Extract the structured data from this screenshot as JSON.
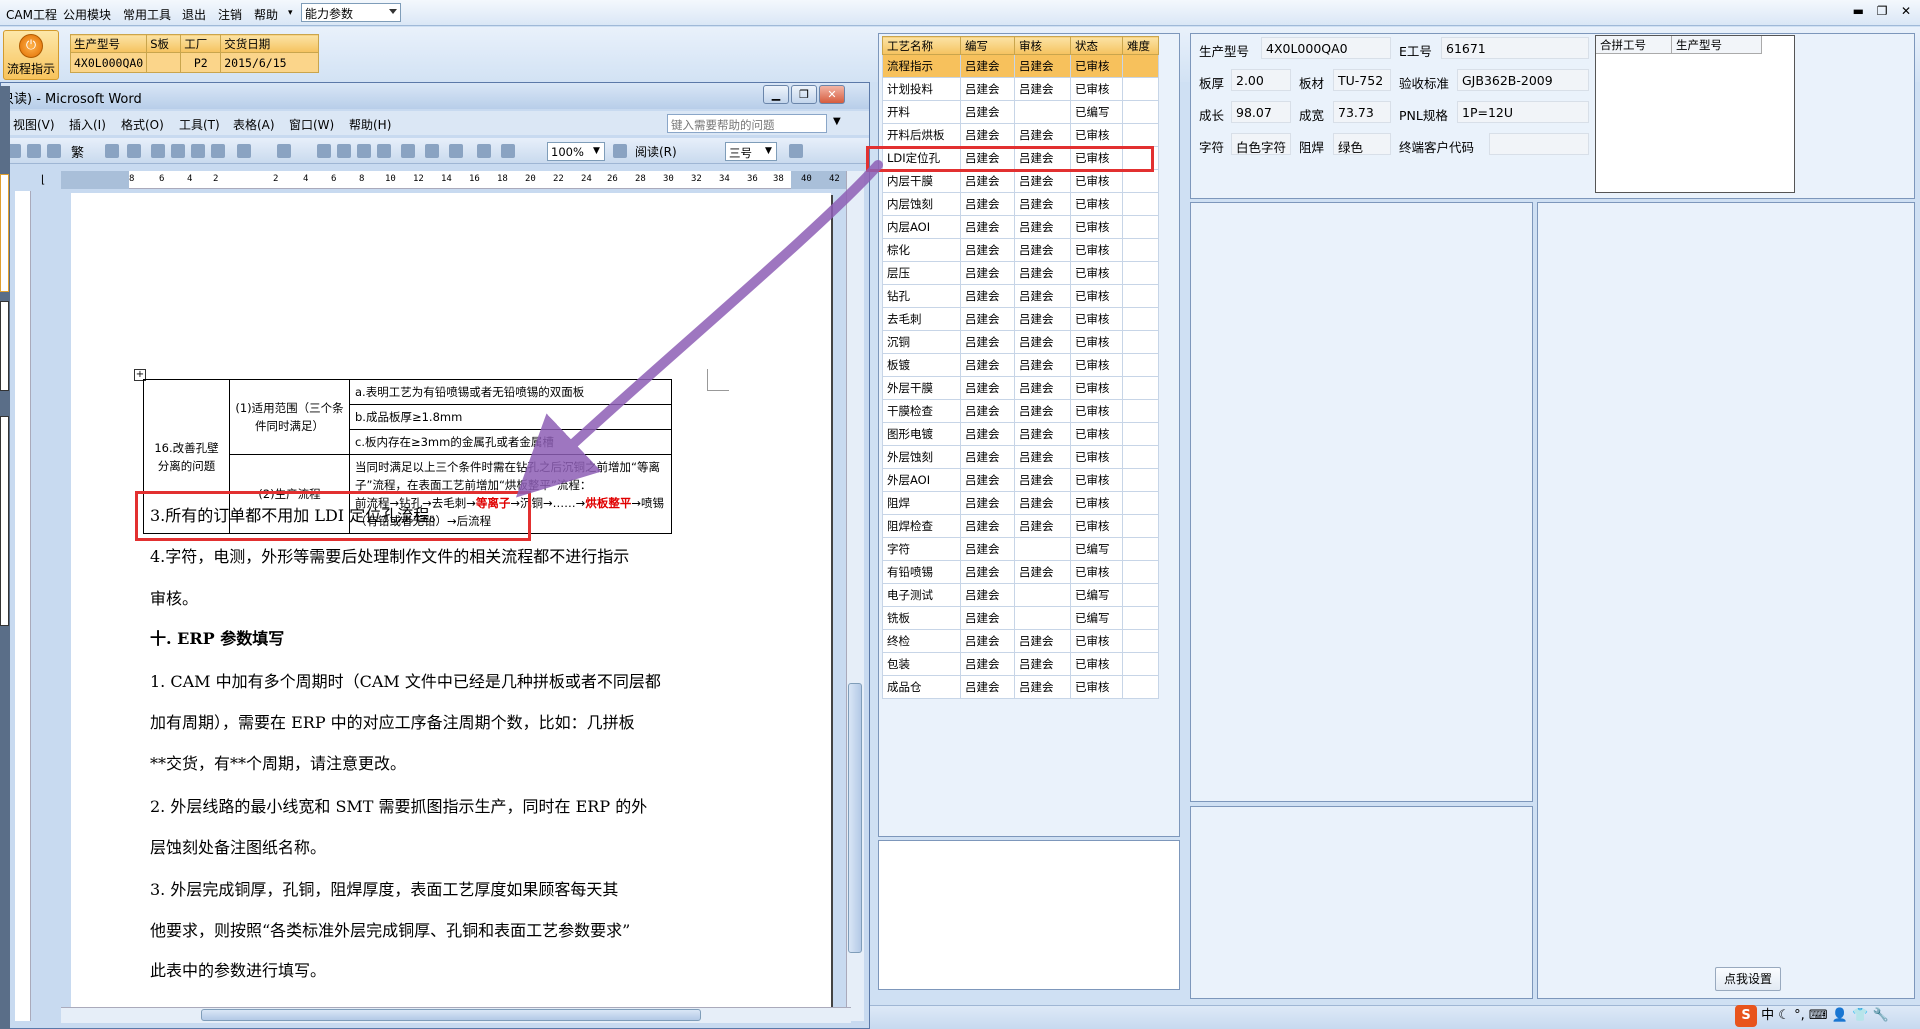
{
  "menubar": {
    "items": [
      "CAM工程",
      "公用模块",
      "常用工具",
      "退出",
      "注销",
      "帮助"
    ],
    "param_combo": "能力参数"
  },
  "ribbon": {
    "flow_button": "流程指示",
    "order_grid": {
      "headers": [
        "生产型号",
        "S板",
        "工厂",
        "交货日期"
      ],
      "row": [
        "4X0L000QA0",
        "",
        "P2",
        "2015/6/15"
      ]
    }
  },
  "word": {
    "title": "只读) - Microsoft Word",
    "menu": [
      "视图(V)",
      "插入(I)",
      "格式(O)",
      "工具(T)",
      "表格(A)",
      "窗口(W)",
      "帮助(H)"
    ],
    "help_placeholder": "键入需要帮助的问题",
    "zoom": "100%",
    "read_label": "阅读(R)",
    "font_size": "三号",
    "ruler_numbers": [
      "8",
      "6",
      "4",
      "2",
      "2",
      "4",
      "6",
      "8",
      "10",
      "12",
      "14",
      "16",
      "18",
      "20",
      "22",
      "24",
      "26",
      "28",
      "30",
      "32",
      "34",
      "36",
      "38",
      "40",
      "42"
    ],
    "table": {
      "item": "16.改善孔壁分离的问题",
      "scope_label": "(1)适用范围（三个条件同时满足）",
      "scope": [
        "a.表明工艺为有铅喷锡或者无铅喷锡的双面板",
        "b.成品板厚≥1.8mm",
        "c.板内存在≥3mm的金属孔或者金属槽"
      ],
      "flow_label": "(2)生产流程",
      "flow_text_1": "当同时满足以上三个条件时需在钻孔之后沉铜之前增加“等离子”流程，在表面工艺前增加“烘板整平”流程：",
      "flow_text_2a": "前流程→钻孔→去毛刺→",
      "flow_text_2b": "等离子",
      "flow_text_2c": "→沉铜→……→",
      "flow_text_2d": "烘板整平",
      "flow_text_2e": "→喷锡（有铅或者无铅）→后流程"
    },
    "lines": {
      "l3": "3.所有的订单都不用加 LDI 定位孔流程。",
      "l4a": "4.字符，电测，外形等需要后处理制作文件的相关流程都不进行指示",
      "l4b": "审核。",
      "h10": "十. ERP 参数填写",
      "p1a": "1. CAM 中加有多个周期时（CAM 文件中已经是几种拼板或者不同层都",
      "p1b": "加有周期），需要在 ERP 中的对应工序备注周期个数，比如：几拼板",
      "p1c": "**交货，有**个周期，请注意更改。",
      "p2a": "2. 外层线路的最小线宽和 SMT 需要抓图指示生产，同时在 ERP 的外",
      "p2b": "层蚀刻处备注图纸名称。",
      "p3a": "3. 外层完成铜厚，孔铜，阻焊厚度，表面工艺厚度如果顾客每天其",
      "p3b": "他要求，则按照“各类标准外层完成铜厚、孔铜和表面工艺参数要求”",
      "p3c": "此表中的参数进行填写。"
    }
  },
  "process": {
    "headers": [
      "工艺名称",
      "编写",
      "审核",
      "状态",
      "难度"
    ],
    "rows": [
      [
        "流程指示",
        "吕建会",
        "吕建会",
        "已审核",
        ""
      ],
      [
        "计划投料",
        "吕建会",
        "吕建会",
        "已审核",
        ""
      ],
      [
        "开料",
        "吕建会",
        "",
        "已编写",
        ""
      ],
      [
        "开料后烘板",
        "吕建会",
        "吕建会",
        "已审核",
        ""
      ],
      [
        "LDI定位孔",
        "吕建会",
        "吕建会",
        "已审核",
        ""
      ],
      [
        "内层干膜",
        "吕建会",
        "吕建会",
        "已审核",
        ""
      ],
      [
        "内层蚀刻",
        "吕建会",
        "吕建会",
        "已审核",
        ""
      ],
      [
        "内层AOI",
        "吕建会",
        "吕建会",
        "已审核",
        ""
      ],
      [
        "棕化",
        "吕建会",
        "吕建会",
        "已审核",
        ""
      ],
      [
        "层压",
        "吕建会",
        "吕建会",
        "已审核",
        ""
      ],
      [
        "钻孔",
        "吕建会",
        "吕建会",
        "已审核",
        ""
      ],
      [
        "去毛刺",
        "吕建会",
        "吕建会",
        "已审核",
        ""
      ],
      [
        "沉铜",
        "吕建会",
        "吕建会",
        "已审核",
        ""
      ],
      [
        "板镀",
        "吕建会",
        "吕建会",
        "已审核",
        ""
      ],
      [
        "外层干膜",
        "吕建会",
        "吕建会",
        "已审核",
        ""
      ],
      [
        "干膜检查",
        "吕建会",
        "吕建会",
        "已审核",
        ""
      ],
      [
        "图形电镀",
        "吕建会",
        "吕建会",
        "已审核",
        ""
      ],
      [
        "外层蚀刻",
        "吕建会",
        "吕建会",
        "已审核",
        ""
      ],
      [
        "外层AOI",
        "吕建会",
        "吕建会",
        "已审核",
        ""
      ],
      [
        "阻焊",
        "吕建会",
        "吕建会",
        "已审核",
        ""
      ],
      [
        "阻焊检查",
        "吕建会",
        "吕建会",
        "已审核",
        ""
      ],
      [
        "字符",
        "吕建会",
        "",
        "已编写",
        ""
      ],
      [
        "有铅喷锡",
        "吕建会",
        "吕建会",
        "已审核",
        ""
      ],
      [
        "电子测试",
        "吕建会",
        "",
        "已编写",
        ""
      ],
      [
        "铣板",
        "吕建会",
        "",
        "已编写",
        ""
      ],
      [
        "终检",
        "吕建会",
        "吕建会",
        "已审核",
        ""
      ],
      [
        "包装",
        "吕建会",
        "吕建会",
        "已审核",
        ""
      ],
      [
        "成品仓",
        "吕建会",
        "吕建会",
        "已审核",
        ""
      ]
    ]
  },
  "info": {
    "model_label": "生产型号",
    "model_value": "4X0L000QA0",
    "eno_label": "E工号",
    "eno_value": "61671",
    "thick_label": "板厚",
    "thick_value": "2.00",
    "material_label": "板材",
    "material_value": "TU-752",
    "std_label": "验收标准",
    "std_value": "GJB362B-2009",
    "len_label": "成长",
    "len_value": "98.07",
    "wid_label": "成宽",
    "wid_value": "73.73",
    "pnl_label": "PNL规格",
    "pnl_value": "1P=12U",
    "char_label": "字符",
    "char_value": "白色字符",
    "mask_label": "阻焊",
    "mask_value": "绿色",
    "cust_label": "终端客户代码",
    "cust_value": "",
    "merge_headers": [
      "合拼工号",
      "生产型号"
    ]
  },
  "settings_button": "点我设置",
  "colors": {
    "highlight_red": "#e23030",
    "arrow_purple": "#8e5fb6",
    "row_selected": "#f7c15c"
  }
}
